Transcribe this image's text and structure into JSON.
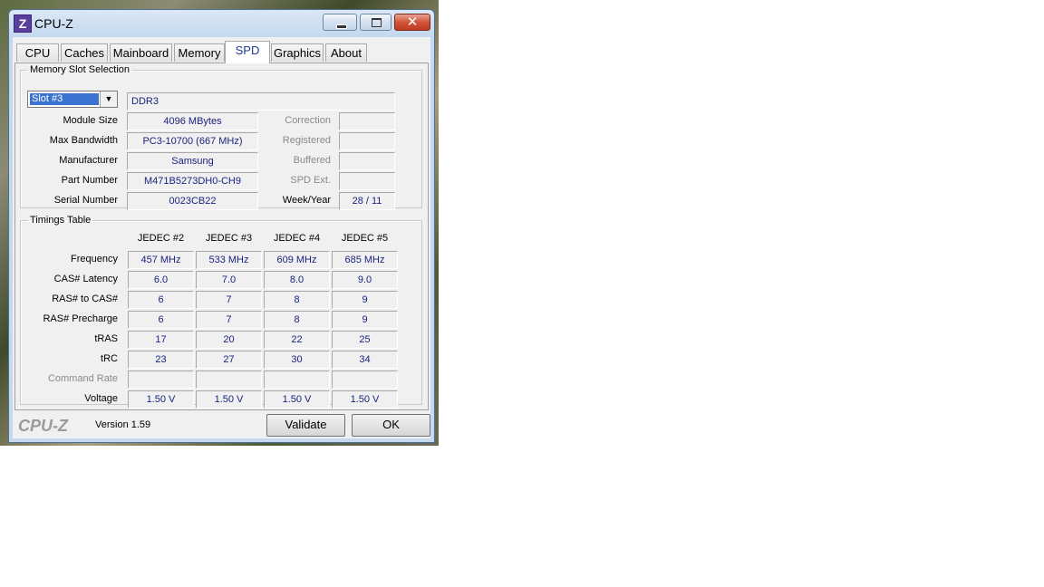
{
  "window": {
    "title": "CPU-Z",
    "close_glyph": "✕"
  },
  "tabs": [
    "CPU",
    "Caches",
    "Mainboard",
    "Memory",
    "SPD",
    "Graphics",
    "About"
  ],
  "active_tab": "SPD",
  "slot_section": {
    "legend": "Memory Slot Selection",
    "slot_value": "Slot #3",
    "memory_type": "DDR3",
    "fields": [
      {
        "label": "Module Size",
        "value": "4096 MBytes"
      },
      {
        "label": "Max Bandwidth",
        "value": "PC3-10700 (667 MHz)"
      },
      {
        "label": "Manufacturer",
        "value": "Samsung"
      },
      {
        "label": "Part Number",
        "value": "M471B5273DH0-CH9"
      },
      {
        "label": "Serial Number",
        "value": "0023CB22"
      }
    ],
    "right_fields": [
      {
        "label": "Correction",
        "value": "",
        "dim": true
      },
      {
        "label": "Registered",
        "value": "",
        "dim": true
      },
      {
        "label": "Buffered",
        "value": "",
        "dim": true
      },
      {
        "label": "SPD Ext.",
        "value": "",
        "dim": true
      },
      {
        "label": "Week/Year",
        "value": "28 / 11",
        "dim": false
      }
    ]
  },
  "timings": {
    "legend": "Timings Table",
    "columns": [
      "JEDEC #2",
      "JEDEC #3",
      "JEDEC #4",
      "JEDEC #5"
    ],
    "rows": [
      {
        "label": "Frequency",
        "values": [
          "457 MHz",
          "533 MHz",
          "609 MHz",
          "685 MHz"
        ]
      },
      {
        "label": "CAS# Latency",
        "values": [
          "6.0",
          "7.0",
          "8.0",
          "9.0"
        ]
      },
      {
        "label": "RAS# to CAS#",
        "values": [
          "6",
          "7",
          "8",
          "9"
        ]
      },
      {
        "label": "RAS# Precharge",
        "values": [
          "6",
          "7",
          "8",
          "9"
        ]
      },
      {
        "label": "tRAS",
        "values": [
          "17",
          "20",
          "22",
          "25"
        ]
      },
      {
        "label": "tRC",
        "values": [
          "23",
          "27",
          "30",
          "34"
        ]
      },
      {
        "label": "Command Rate",
        "values": [
          "",
          "",
          "",
          ""
        ],
        "dim": true
      },
      {
        "label": "Voltage",
        "values": [
          "1.50 V",
          "1.50 V",
          "1.50 V",
          "1.50 V"
        ]
      }
    ]
  },
  "footer": {
    "logo": "CPU-Z",
    "version": "Version 1.59",
    "validate_label": "Validate",
    "ok_label": "OK"
  }
}
